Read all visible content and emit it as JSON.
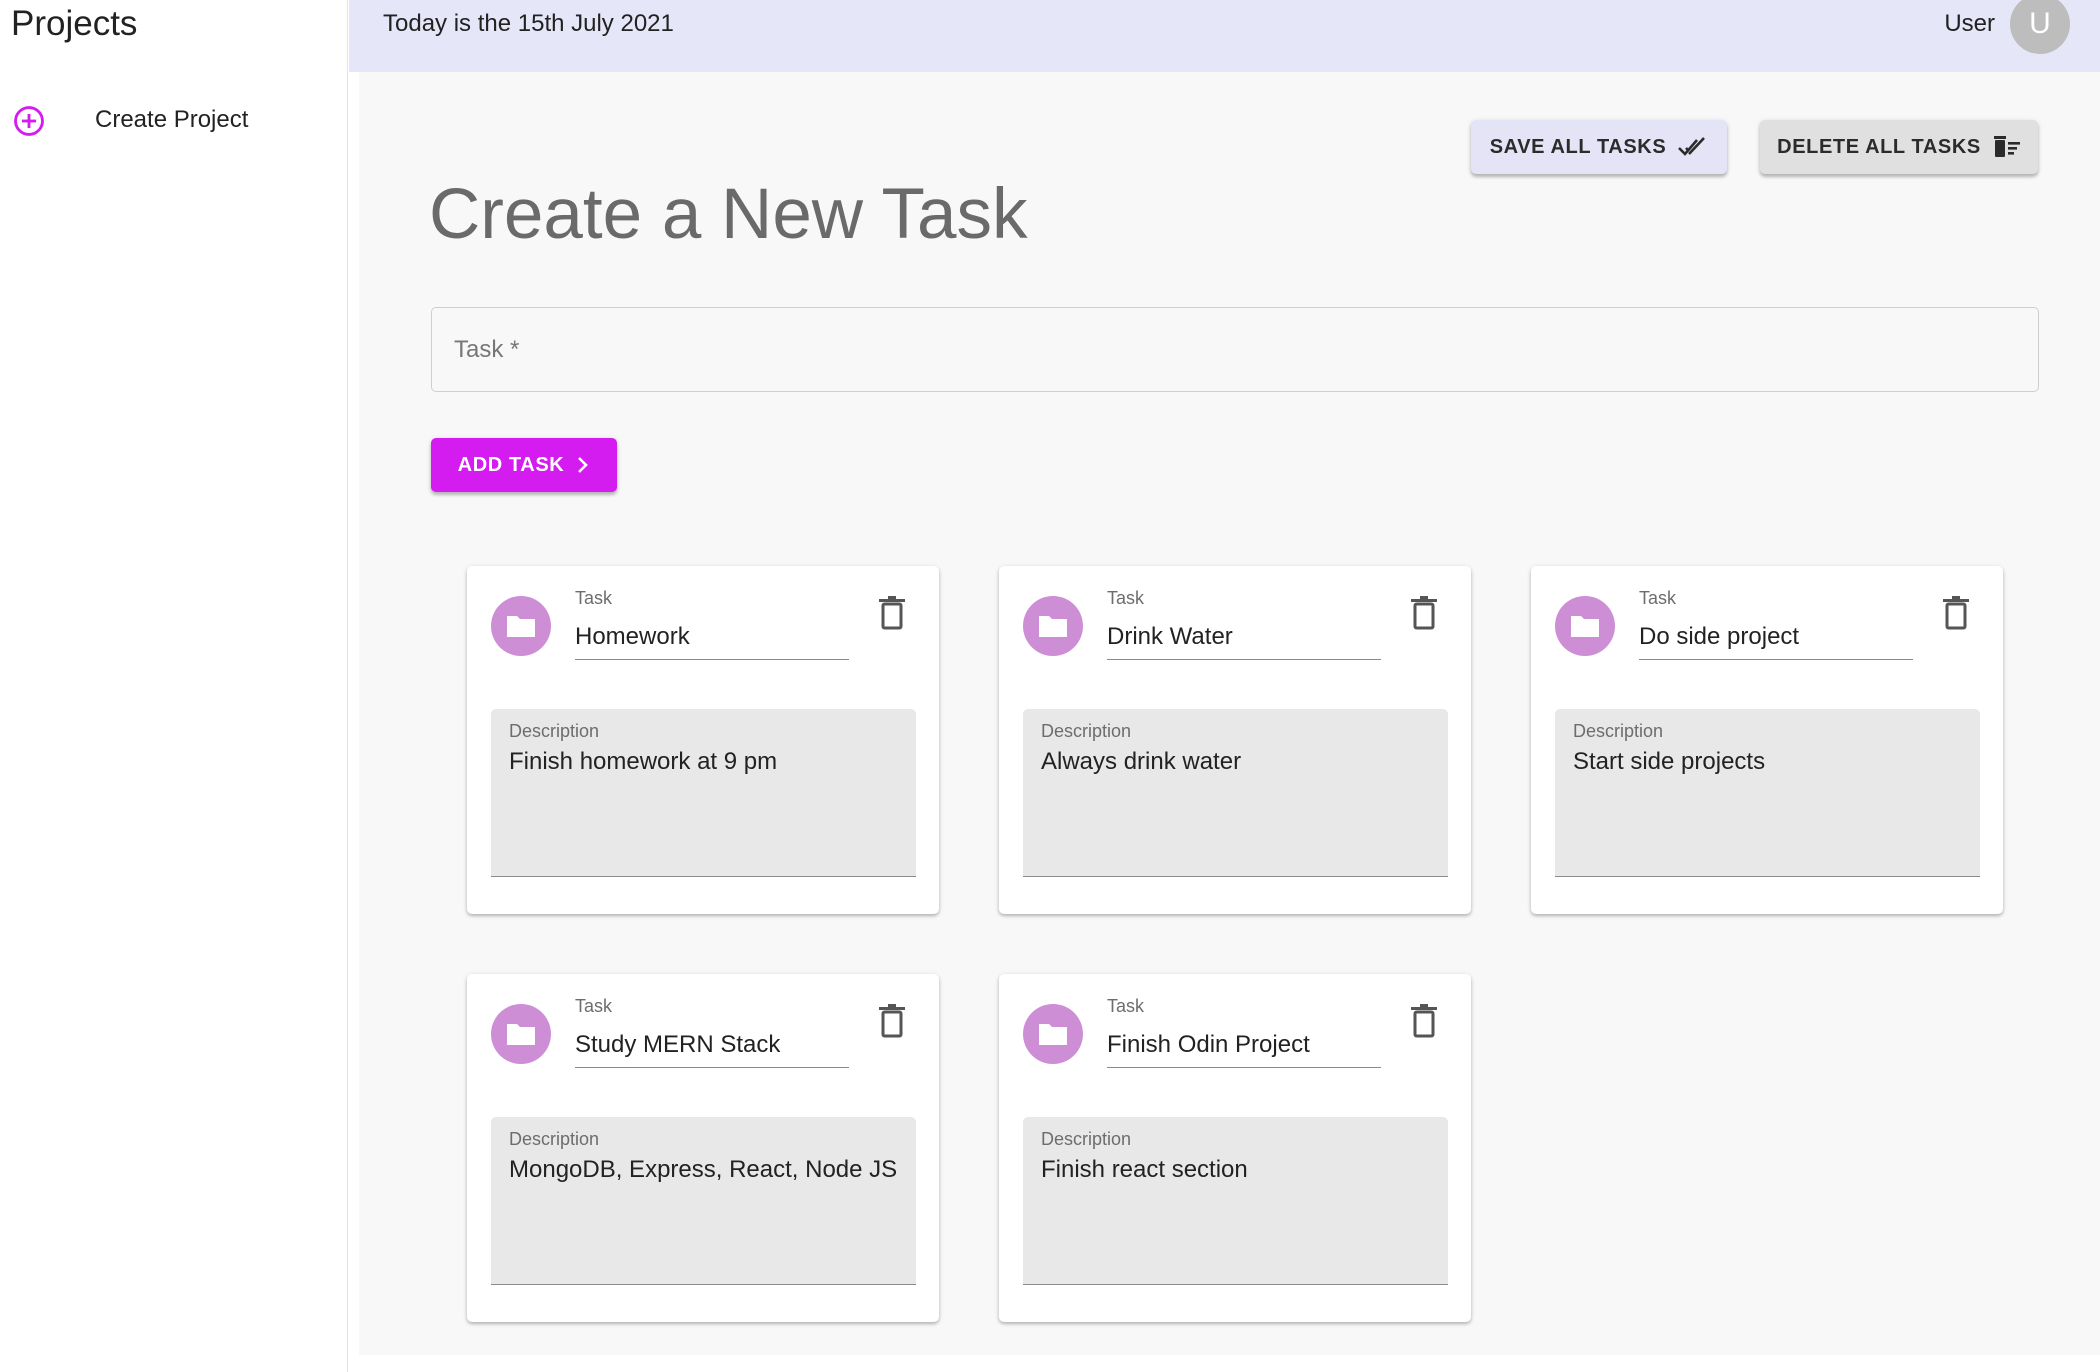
{
  "sidebar": {
    "title": "Projects",
    "items": [
      {
        "label": "Create Project",
        "icon": "add-circle-icon"
      }
    ]
  },
  "header": {
    "date_text": "Today is the 15th July 2021",
    "user_label": "User",
    "avatar_initial": "U"
  },
  "toolbar": {
    "save_label": "SAVE ALL TASKS",
    "delete_label": "DELETE ALL TASKS"
  },
  "main": {
    "title": "Create a New Task",
    "task_input": {
      "placeholder": "Task *",
      "value": ""
    },
    "add_label": "ADD TASK"
  },
  "tasks": [
    {
      "task_label": "Task",
      "name": "Homework",
      "description_label": "Description",
      "description": "Finish homework at 9 pm"
    },
    {
      "task_label": "Task",
      "name": "Drink Water",
      "description_label": "Description",
      "description": "Always drink water"
    },
    {
      "task_label": "Task",
      "name": "Do side project",
      "description_label": "Description",
      "description": "Start side projects"
    },
    {
      "task_label": "Task",
      "name": "Study MERN Stack",
      "description_label": "Description",
      "description": "MongoDB, Express, React, Node JS"
    },
    {
      "task_label": "Task",
      "name": "Finish Odin Project",
      "description_label": "Description",
      "description": "Finish react section"
    }
  ],
  "colors": {
    "accent": "#d41cf0",
    "header_bg": "#e6e6f9",
    "folder_avatar": "#cd8ed6",
    "save_button_bg": "#e4e4f6"
  }
}
